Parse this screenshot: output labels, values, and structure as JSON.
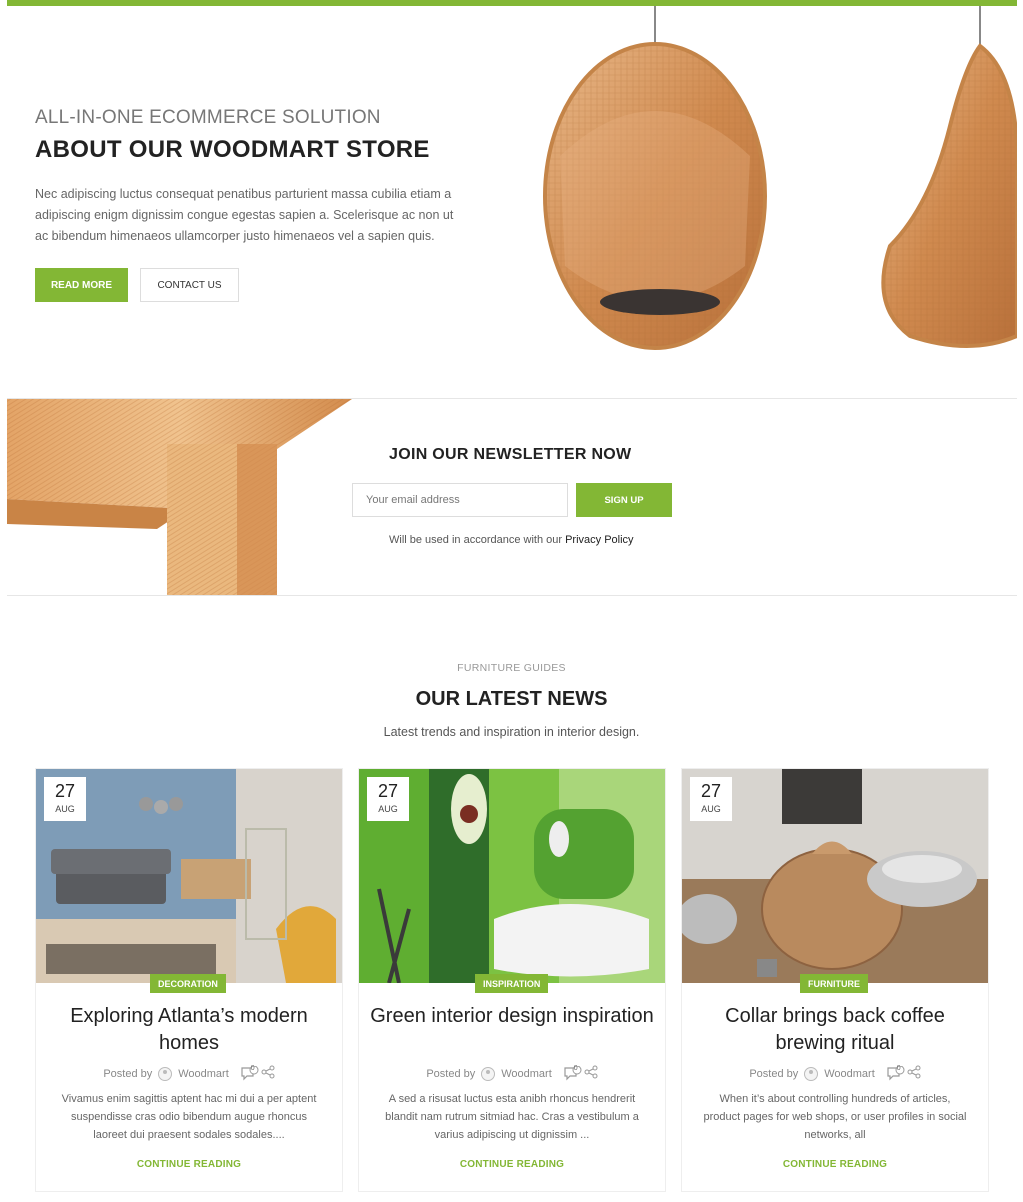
{
  "hero": {
    "subtitle": "ALL-IN-ONE ECOMMERCE SOLUTION",
    "title": "ABOUT OUR WOODMART STORE",
    "text": "Nec  adipiscing luctus consequat penatibus parturient massa cubilia etiam a adipiscing enigm dignissim congue egestas sapien a. Scelerisque ac non ut ac bibendum himenaeos ullamcorper justo himenaeos vel a sapien quis.",
    "read_more": "READ MORE",
    "contact": "CONTACT US"
  },
  "newsletter": {
    "title": "JOIN OUR NEWSLETTER NOW",
    "placeholder": "Your email address",
    "button": "SIGN UP",
    "note": "Will be used in accordance with our",
    "policy": "Privacy Policy"
  },
  "news": {
    "eyebrow": "FURNITURE GUIDES",
    "title": "OUR LATEST NEWS",
    "subtitle": "Latest trends and inspiration in interior design.",
    "posts": [
      {
        "day": "27",
        "month": "AUG",
        "category": "DECORATION",
        "title": "Exploring Atlanta’s modern homes",
        "posted_by": "Posted by",
        "author": "Woodmart",
        "comments": "0",
        "excerpt": "Vivamus enim sagittis aptent hac mi dui a per aptent suspendisse cras odio bibendum augue rhoncus laoreet dui praesent sodales sodales....",
        "more": "CONTINUE READING"
      },
      {
        "day": "27",
        "month": "AUG",
        "category": "INSPIRATION",
        "title": "Green interior design inspiration",
        "posted_by": "Posted by",
        "author": "Woodmart",
        "comments": "0",
        "excerpt": "A sed a risusat luctus esta anibh rhoncus hendrerit blandit nam rutrum sitmiad hac. Cras a vestibulum a varius adipiscing ut dignissim ...",
        "more": "CONTINUE READING"
      },
      {
        "day": "27",
        "month": "AUG",
        "category": "FURNITURE",
        "title": "Collar brings back coffee brewing ritual",
        "posted_by": "Posted by",
        "author": "Woodmart",
        "comments": "0",
        "excerpt": "When it’s about controlling hundreds of articles, product pages for web shops, or user profiles in social networks, all",
        "more": "CONTINUE READING"
      }
    ]
  },
  "colors": {
    "accent": "#83b735"
  }
}
